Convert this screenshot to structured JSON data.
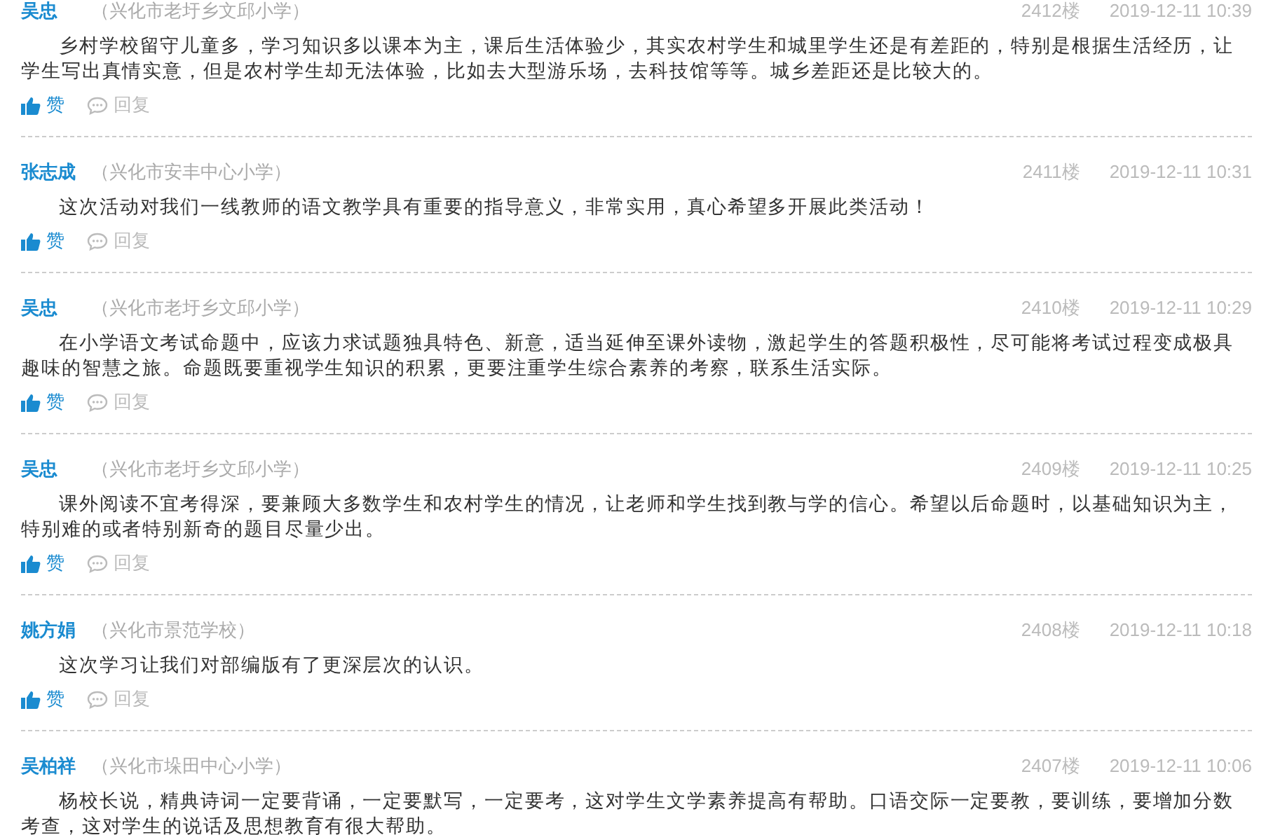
{
  "comments": [
    {
      "author": "吴忠",
      "school": "（兴化市老圩乡文邱小学）",
      "floor": "2412楼",
      "time": "2019-12-11 10:39",
      "text": "乡村学校留守儿童多，学习知识多以课本为主，课后生活体验少，其实农村学生和城里学生还是有差距的，特别是根据生活经历，让学生写出真情实意，但是农村学生却无法体验，比如去大型游乐场，去科技馆等等。城乡差距还是比较大的。",
      "like": "赞",
      "reply": "回复"
    },
    {
      "author": "张志成",
      "school": "（兴化市安丰中心小学）",
      "floor": "2411楼",
      "time": "2019-12-11 10:31",
      "text": "这次活动对我们一线教师的语文教学具有重要的指导意义，非常实用，真心希望多开展此类活动！",
      "like": "赞",
      "reply": "回复"
    },
    {
      "author": "吴忠",
      "school": "（兴化市老圩乡文邱小学）",
      "floor": "2410楼",
      "time": "2019-12-11 10:29",
      "text": "在小学语文考试命题中，应该力求试题独具特色、新意，适当延伸至课外读物，激起学生的答题积极性，尽可能将考试过程变成极具趣味的智慧之旅。命题既要重视学生知识的积累，更要注重学生综合素养的考察，联系生活实际。",
      "like": "赞",
      "reply": "回复"
    },
    {
      "author": "吴忠",
      "school": "（兴化市老圩乡文邱小学）",
      "floor": "2409楼",
      "time": "2019-12-11 10:25",
      "text": "课外阅读不宜考得深，要兼顾大多数学生和农村学生的情况，让老师和学生找到教与学的信心。希望以后命题时，以基础知识为主，特别难的或者特别新奇的题目尽量少出。",
      "like": "赞",
      "reply": "回复"
    },
    {
      "author": "姚方娟",
      "school": "（兴化市景范学校）",
      "floor": "2408楼",
      "time": "2019-12-11 10:18",
      "text": "这次学习让我们对部编版有了更深层次的认识。",
      "like": "赞",
      "reply": "回复"
    },
    {
      "author": "吴柏祥",
      "school": "（兴化市垛田中心小学）",
      "floor": "2407楼",
      "time": "2019-12-11 10:06",
      "text": "杨校长说，精典诗词一定要背诵，一定要默写，一定要考，这对学生文学素养提高有帮助。口语交际一定要教，要训练，要增加分数考查，这对学生的说话及思想教育有很大帮助。"
    }
  ]
}
